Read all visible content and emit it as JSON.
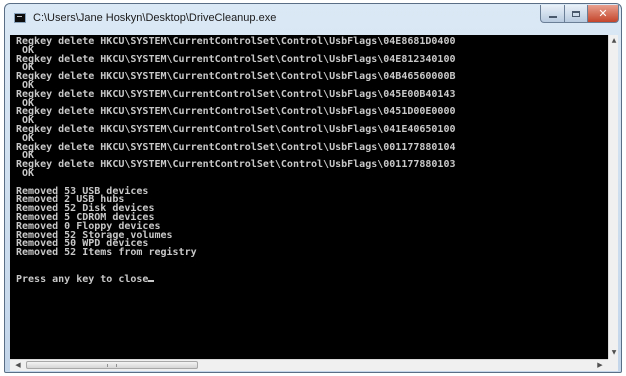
{
  "window": {
    "title": "C:\\Users\\Jane Hoskyn\\Desktop\\DriveCleanup.exe",
    "icon": "console-app-icon"
  },
  "controls": {
    "minimize": "minimize-icon",
    "maximize": "maximize-icon",
    "close": "close-icon",
    "close_glyph": "✕"
  },
  "console": {
    "lines": [
      "Regkey delete HKCU\\SYSTEM\\CurrentControlSet\\Control\\UsbFlags\\04E8681D0400",
      " OK",
      "Regkey delete HKCU\\SYSTEM\\CurrentControlSet\\Control\\UsbFlags\\04E812340100",
      " OK",
      "Regkey delete HKCU\\SYSTEM\\CurrentControlSet\\Control\\UsbFlags\\04B46560000B",
      " OK",
      "Regkey delete HKCU\\SYSTEM\\CurrentControlSet\\Control\\UsbFlags\\045E00B40143",
      " OK",
      "Regkey delete HKCU\\SYSTEM\\CurrentControlSet\\Control\\UsbFlags\\0451D00E0000",
      " OK",
      "Regkey delete HKCU\\SYSTEM\\CurrentControlSet\\Control\\UsbFlags\\041E40650100",
      " OK",
      "Regkey delete HKCU\\SYSTEM\\CurrentControlSet\\Control\\UsbFlags\\001177880104",
      " OK",
      "Regkey delete HKCU\\SYSTEM\\CurrentControlSet\\Control\\UsbFlags\\001177880103",
      " OK",
      "",
      "Removed 53 USB devices",
      "Removed 2 USB hubs",
      "Removed 52 Disk devices",
      "Removed 5 CDROM devices",
      "Removed 0 Floppy devices",
      "Removed 52 Storage volumes",
      "Removed 50 WPD devices",
      "Removed 52 Items from registry",
      "",
      "",
      "Press any key to close"
    ],
    "background_color": "#000000",
    "text_color": "#c8c8c8"
  },
  "scrollbars": {
    "up_arrow": "▲",
    "down_arrow": "▼",
    "left_arrow": "◀",
    "right_arrow": "▶"
  }
}
